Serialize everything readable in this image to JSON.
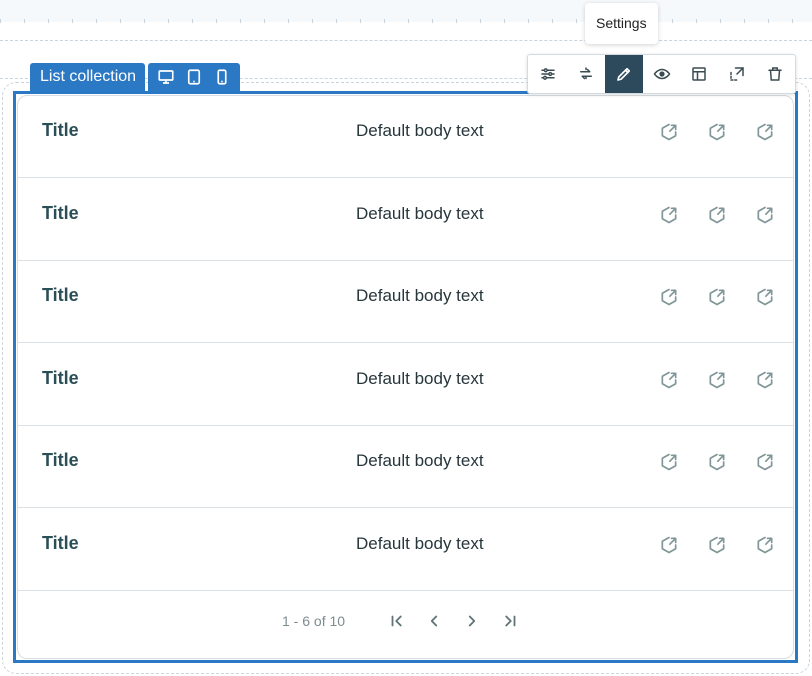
{
  "component_label": {
    "name": "List collection",
    "devices": [
      {
        "name": "desktop",
        "icon": "desktop-icon"
      },
      {
        "name": "tablet",
        "icon": "tablet-icon"
      },
      {
        "name": "mobile",
        "icon": "mobile-icon"
      }
    ]
  },
  "tooltip": {
    "text": "Settings"
  },
  "toolbar": {
    "tools": [
      {
        "icon": "sliders-icon",
        "active": false
      },
      {
        "icon": "swap-icon",
        "active": false
      },
      {
        "icon": "pencil-icon",
        "active": true
      },
      {
        "icon": "eye-icon",
        "active": false
      },
      {
        "icon": "layout-icon",
        "active": false
      },
      {
        "icon": "detach-icon",
        "active": false
      },
      {
        "icon": "trash-icon",
        "active": false
      }
    ]
  },
  "list": {
    "rows": [
      {
        "title": "Title",
        "body": "Default body text"
      },
      {
        "title": "Title",
        "body": "Default body text"
      },
      {
        "title": "Title",
        "body": "Default body text"
      },
      {
        "title": "Title",
        "body": "Default body text"
      },
      {
        "title": "Title",
        "body": "Default body text"
      },
      {
        "title": "Title",
        "body": "Default body text"
      }
    ],
    "row_action_icon": "share-icon",
    "actions_per_row": 3
  },
  "pagination": {
    "text": "1 - 6 of 10",
    "buttons": [
      "first-page-icon",
      "prev-page-icon",
      "next-page-icon",
      "last-page-icon"
    ]
  },
  "colors": {
    "accent": "#2b78c5",
    "active_tool": "#2c4a5c",
    "title_text": "#2a4f57",
    "icon_muted": "#7f9598"
  }
}
